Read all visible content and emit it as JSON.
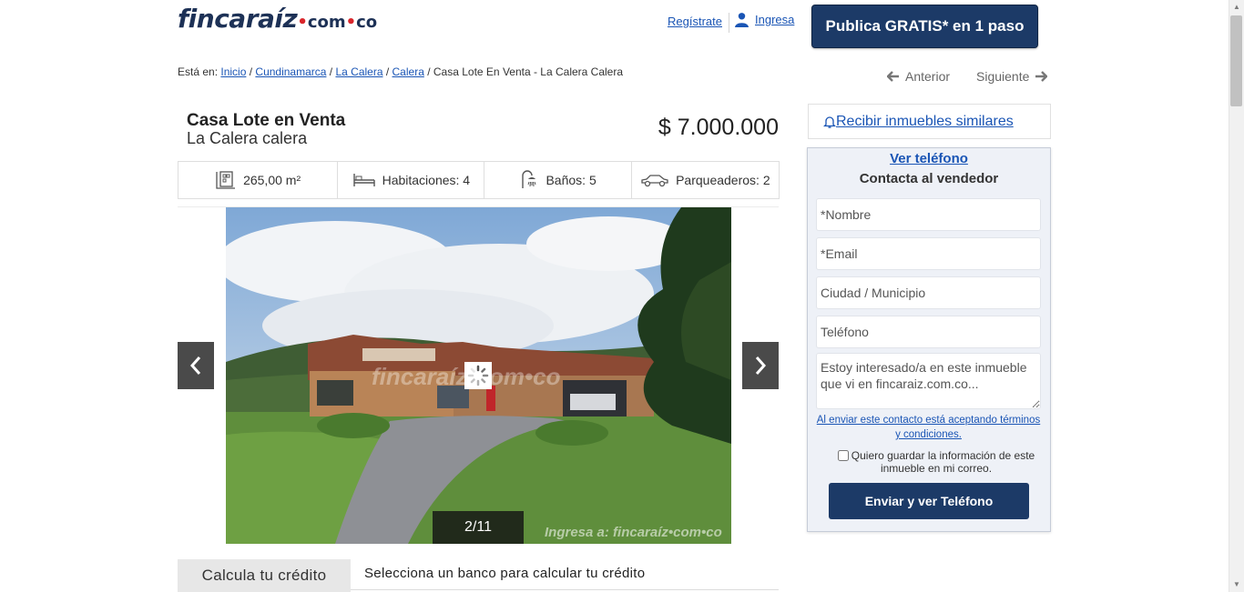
{
  "header": {
    "logo_main": "fincaraíz",
    "logo_domain": "com",
    "logo_tld": "co",
    "register_label": "Regístrate",
    "login_label": "Ingresa",
    "publish_label": "Publica GRATIS* en 1 paso"
  },
  "breadcrumb": {
    "prefix": "Está en:",
    "items": [
      "Inicio",
      "Cundinamarca",
      "La Calera",
      "Calera"
    ],
    "current": "Casa Lote En Venta - La Calera Calera"
  },
  "pager": {
    "prev_label": "Anterior",
    "next_label": "Siguiente"
  },
  "listing": {
    "title": "Casa Lote en Venta",
    "subtitle": "La Calera calera",
    "price": "$ 7.000.000",
    "features": [
      {
        "icon": "area-icon",
        "label": "265,00 m²"
      },
      {
        "icon": "bed-icon",
        "label": "Habitaciones: 4"
      },
      {
        "icon": "shower-icon",
        "label": "Baños: 5"
      },
      {
        "icon": "car-icon",
        "label": "Parqueaderos: 2"
      }
    ]
  },
  "gallery": {
    "counter": "2/11",
    "watermark": "fincaraíz.com.co",
    "watermark_corner": "Ingresa a: fincaraíz.com.co"
  },
  "credit": {
    "tab_label": "Calcula tu crédito",
    "text": "Selecciona un banco para calcular tu crédito"
  },
  "sidebar": {
    "similar_label": "Recibir inmuebles similares",
    "contact": {
      "show_phone": "Ver teléfono",
      "heading": "Contacta al vendedor",
      "name_ph": "*Nombre",
      "email_ph": "*Email",
      "city_ph": "Ciudad / Municipio",
      "phone_ph": "Teléfono",
      "message_value": "Estoy interesado/a en este inmueble que vi en fincaraiz.com.co...",
      "terms": "Al enviar este contacto está aceptando términos y condiciones.",
      "save_label": "Quiero guardar la información de este inmueble en mi correo.",
      "submit_label": "Enviar y ver Teléfono"
    }
  },
  "colors": {
    "brand_navy": "#1c3a67",
    "link_blue": "#1a55b5",
    "accent_red": "#d9262b",
    "panel_bg": "#eef1f7"
  }
}
